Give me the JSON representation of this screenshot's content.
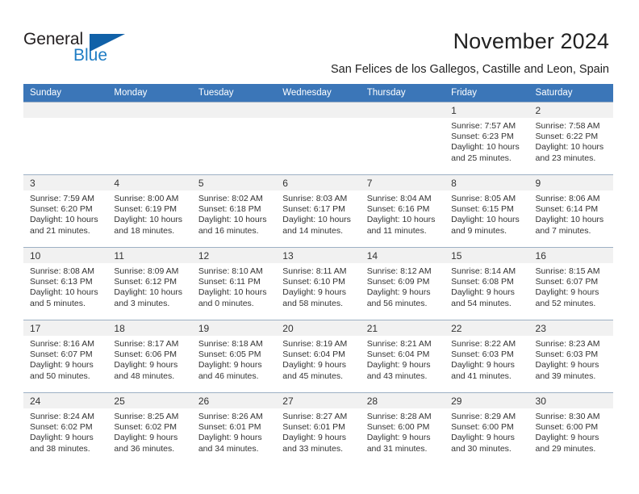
{
  "brand": {
    "name_part1": "General",
    "name_part2": "Blue",
    "accent_color": "#1f7dc4",
    "triangle_color": "#1161a8"
  },
  "header": {
    "title": "November 2024",
    "subtitle": "San Felices de los Gallegos, Castille and Leon, Spain",
    "header_bg_color": "#3b76b8",
    "daynum_band_color": "#f1f1f1"
  },
  "calendar": {
    "weekday_headers": [
      "Sunday",
      "Monday",
      "Tuesday",
      "Wednesday",
      "Thursday",
      "Friday",
      "Saturday"
    ],
    "weeks": [
      [
        {
          "day": "",
          "lines": []
        },
        {
          "day": "",
          "lines": []
        },
        {
          "day": "",
          "lines": []
        },
        {
          "day": "",
          "lines": []
        },
        {
          "day": "",
          "lines": []
        },
        {
          "day": "1",
          "lines": [
            "Sunrise: 7:57 AM",
            "Sunset: 6:23 PM",
            "Daylight: 10 hours and 25 minutes."
          ]
        },
        {
          "day": "2",
          "lines": [
            "Sunrise: 7:58 AM",
            "Sunset: 6:22 PM",
            "Daylight: 10 hours and 23 minutes."
          ]
        }
      ],
      [
        {
          "day": "3",
          "lines": [
            "Sunrise: 7:59 AM",
            "Sunset: 6:20 PM",
            "Daylight: 10 hours and 21 minutes."
          ]
        },
        {
          "day": "4",
          "lines": [
            "Sunrise: 8:00 AM",
            "Sunset: 6:19 PM",
            "Daylight: 10 hours and 18 minutes."
          ]
        },
        {
          "day": "5",
          "lines": [
            "Sunrise: 8:02 AM",
            "Sunset: 6:18 PM",
            "Daylight: 10 hours and 16 minutes."
          ]
        },
        {
          "day": "6",
          "lines": [
            "Sunrise: 8:03 AM",
            "Sunset: 6:17 PM",
            "Daylight: 10 hours and 14 minutes."
          ]
        },
        {
          "day": "7",
          "lines": [
            "Sunrise: 8:04 AM",
            "Sunset: 6:16 PM",
            "Daylight: 10 hours and 11 minutes."
          ]
        },
        {
          "day": "8",
          "lines": [
            "Sunrise: 8:05 AM",
            "Sunset: 6:15 PM",
            "Daylight: 10 hours and 9 minutes."
          ]
        },
        {
          "day": "9",
          "lines": [
            "Sunrise: 8:06 AM",
            "Sunset: 6:14 PM",
            "Daylight: 10 hours and 7 minutes."
          ]
        }
      ],
      [
        {
          "day": "10",
          "lines": [
            "Sunrise: 8:08 AM",
            "Sunset: 6:13 PM",
            "Daylight: 10 hours and 5 minutes."
          ]
        },
        {
          "day": "11",
          "lines": [
            "Sunrise: 8:09 AM",
            "Sunset: 6:12 PM",
            "Daylight: 10 hours and 3 minutes."
          ]
        },
        {
          "day": "12",
          "lines": [
            "Sunrise: 8:10 AM",
            "Sunset: 6:11 PM",
            "Daylight: 10 hours and 0 minutes."
          ]
        },
        {
          "day": "13",
          "lines": [
            "Sunrise: 8:11 AM",
            "Sunset: 6:10 PM",
            "Daylight: 9 hours and 58 minutes."
          ]
        },
        {
          "day": "14",
          "lines": [
            "Sunrise: 8:12 AM",
            "Sunset: 6:09 PM",
            "Daylight: 9 hours and 56 minutes."
          ]
        },
        {
          "day": "15",
          "lines": [
            "Sunrise: 8:14 AM",
            "Sunset: 6:08 PM",
            "Daylight: 9 hours and 54 minutes."
          ]
        },
        {
          "day": "16",
          "lines": [
            "Sunrise: 8:15 AM",
            "Sunset: 6:07 PM",
            "Daylight: 9 hours and 52 minutes."
          ]
        }
      ],
      [
        {
          "day": "17",
          "lines": [
            "Sunrise: 8:16 AM",
            "Sunset: 6:07 PM",
            "Daylight: 9 hours and 50 minutes."
          ]
        },
        {
          "day": "18",
          "lines": [
            "Sunrise: 8:17 AM",
            "Sunset: 6:06 PM",
            "Daylight: 9 hours and 48 minutes."
          ]
        },
        {
          "day": "19",
          "lines": [
            "Sunrise: 8:18 AM",
            "Sunset: 6:05 PM",
            "Daylight: 9 hours and 46 minutes."
          ]
        },
        {
          "day": "20",
          "lines": [
            "Sunrise: 8:19 AM",
            "Sunset: 6:04 PM",
            "Daylight: 9 hours and 45 minutes."
          ]
        },
        {
          "day": "21",
          "lines": [
            "Sunrise: 8:21 AM",
            "Sunset: 6:04 PM",
            "Daylight: 9 hours and 43 minutes."
          ]
        },
        {
          "day": "22",
          "lines": [
            "Sunrise: 8:22 AM",
            "Sunset: 6:03 PM",
            "Daylight: 9 hours and 41 minutes."
          ]
        },
        {
          "day": "23",
          "lines": [
            "Sunrise: 8:23 AM",
            "Sunset: 6:03 PM",
            "Daylight: 9 hours and 39 minutes."
          ]
        }
      ],
      [
        {
          "day": "24",
          "lines": [
            "Sunrise: 8:24 AM",
            "Sunset: 6:02 PM",
            "Daylight: 9 hours and 38 minutes."
          ]
        },
        {
          "day": "25",
          "lines": [
            "Sunrise: 8:25 AM",
            "Sunset: 6:02 PM",
            "Daylight: 9 hours and 36 minutes."
          ]
        },
        {
          "day": "26",
          "lines": [
            "Sunrise: 8:26 AM",
            "Sunset: 6:01 PM",
            "Daylight: 9 hours and 34 minutes."
          ]
        },
        {
          "day": "27",
          "lines": [
            "Sunrise: 8:27 AM",
            "Sunset: 6:01 PM",
            "Daylight: 9 hours and 33 minutes."
          ]
        },
        {
          "day": "28",
          "lines": [
            "Sunrise: 8:28 AM",
            "Sunset: 6:00 PM",
            "Daylight: 9 hours and 31 minutes."
          ]
        },
        {
          "day": "29",
          "lines": [
            "Sunrise: 8:29 AM",
            "Sunset: 6:00 PM",
            "Daylight: 9 hours and 30 minutes."
          ]
        },
        {
          "day": "30",
          "lines": [
            "Sunrise: 8:30 AM",
            "Sunset: 6:00 PM",
            "Daylight: 9 hours and 29 minutes."
          ]
        }
      ]
    ]
  }
}
